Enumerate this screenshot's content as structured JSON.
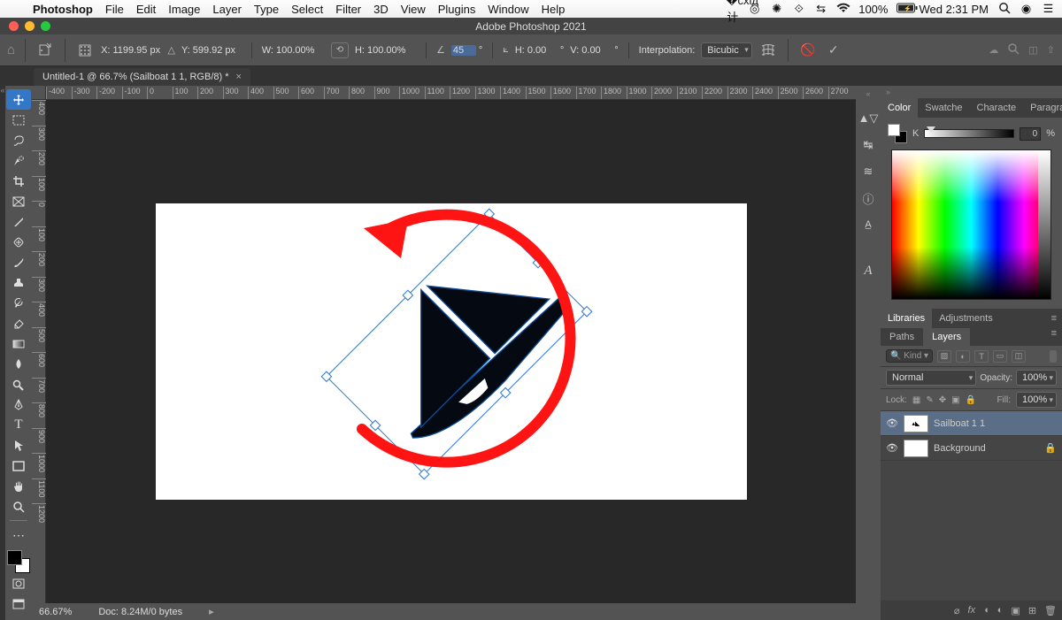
{
  "mac_menu": {
    "app": "Photoshop",
    "items": [
      "File",
      "Edit",
      "Image",
      "Layer",
      "Type",
      "Select",
      "Filter",
      "3D",
      "View",
      "Plugins",
      "Window",
      "Help"
    ],
    "battery": "100%",
    "clock": "Wed 2:31 PM"
  },
  "window_title": "Adobe Photoshop 2021",
  "options_bar": {
    "x_label": "X:",
    "x_value": "1199.95 px",
    "y_label": "Y:",
    "y_value": "599.92 px",
    "w_label": "W:",
    "w_value": "100.00%",
    "h_label": "H:",
    "h_value": "100.00%",
    "rot_value": "45",
    "skewh_label": "H:",
    "skewh_value": "0.00",
    "skewv_label": "V:",
    "skewv_value": "0.00",
    "interp_label": "Interpolation:",
    "interp_value": "Bicubic"
  },
  "document_tab": "Untitled-1 @ 66.7% (Sailboat 1 1, RGB/8) *",
  "ruler_h": [
    "-400",
    "-300",
    "-200",
    "-100",
    "0",
    "100",
    "200",
    "300",
    "400",
    "500",
    "600",
    "700",
    "800",
    "900",
    "1000",
    "1100",
    "1200",
    "1300",
    "1400",
    "1500",
    "1600",
    "1700",
    "1800",
    "1900",
    "2000",
    "2100",
    "2200",
    "2300",
    "2400",
    "2500",
    "2600",
    "2700"
  ],
  "ruler_v": [
    "400",
    "300",
    "200",
    "100",
    "0",
    "100",
    "200",
    "300",
    "400",
    "500",
    "600",
    "700",
    "800",
    "900",
    "1000",
    "1100",
    "1200"
  ],
  "status": {
    "zoom": "66.67%",
    "doc": "Doc: 8.24M/0 bytes"
  },
  "color_panel": {
    "tabs": [
      "Color",
      "Swatche",
      "Characte",
      "Paragrap"
    ],
    "channel": "K",
    "value": "0",
    "unit": "%"
  },
  "libraries_panel": {
    "tabs": [
      "Libraries",
      "Adjustments"
    ]
  },
  "layers_panel": {
    "tabs": [
      "Paths",
      "Layers"
    ],
    "filter_label": "Kind",
    "blend_label": "Normal",
    "opacity_label": "Opacity:",
    "opacity_value": "100%",
    "lock_label": "Lock:",
    "fill_label": "Fill:",
    "fill_value": "100%",
    "layers": [
      {
        "name": "Sailboat 1 1",
        "selected": true,
        "locked": false
      },
      {
        "name": "Background",
        "selected": false,
        "locked": true
      }
    ]
  }
}
